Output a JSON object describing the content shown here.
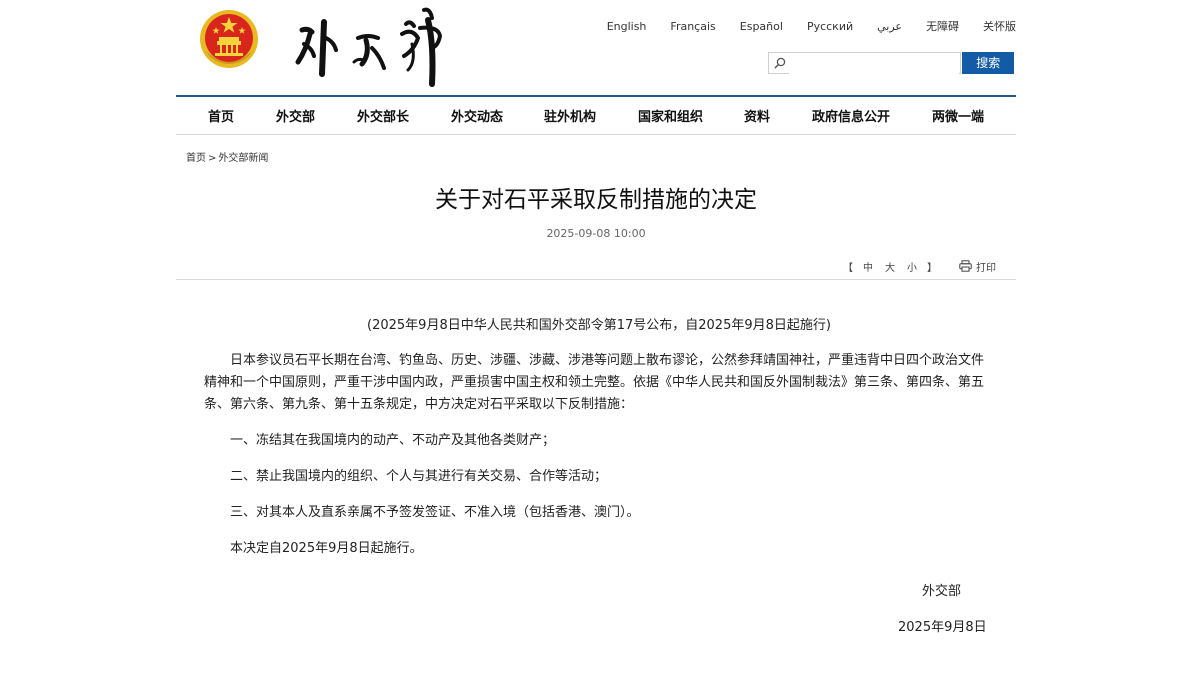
{
  "header": {
    "languages": [
      "English",
      "Français",
      "Español",
      "Русский",
      "عربي",
      "无障碍",
      "关怀版"
    ],
    "search": {
      "placeholder": "",
      "button_label": "搜索"
    }
  },
  "nav": {
    "items": [
      "首页",
      "外交部",
      "外交部长",
      "外交动态",
      "驻外机构",
      "国家和组织",
      "资料",
      "政府信息公开",
      "两微一端"
    ]
  },
  "breadcrumb": {
    "home": "首页",
    "separator": ">",
    "current": "外交部新闻"
  },
  "article": {
    "title": "关于对石平采取反制措施的决定",
    "date": "2025-09-08 10:00",
    "font_tools": {
      "open": "【",
      "medium": "中",
      "large": "大",
      "small": "小",
      "close": "】",
      "print": "打印"
    },
    "subtitle": "(2025年9月8日中华人民共和国外交部令第17号公布，自2025年9月8日起施行)",
    "paragraphs": [
      "日本参议员石平长期在台湾、钓鱼岛、历史、涉疆、涉藏、涉港等问题上散布谬论，公然参拜靖国神社，严重违背中日四个政治文件精神和一个中国原则，严重干涉中国内政，严重损害中国主权和领土完整。依据《中华人民共和国反外国制裁法》第三条、第四条、第五条、第六条、第九条、第十五条规定，中方决定对石平采取以下反制措施：",
      "一、冻结其在我国境内的动产、不动产及其他各类财产；",
      "二、禁止我国境内的组织、个人与其进行有关交易、合作等活动；",
      "三、对其本人及直系亲属不予签发签证、不准入境（包括香港、澳门）。",
      "本决定自2025年9月8日起施行。"
    ],
    "signature": "外交部",
    "sign_date": "2025年9月8日"
  }
}
